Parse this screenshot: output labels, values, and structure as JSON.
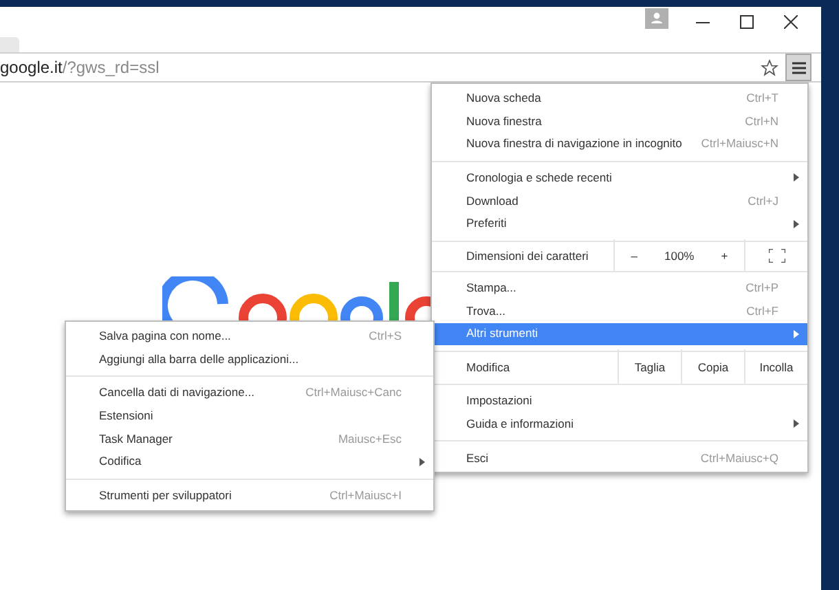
{
  "address_bar": {
    "host": "google.it",
    "path": "/?gws_rd=ssl",
    "menu_button_active": true
  },
  "menu": [
    {
      "kind": "item",
      "label": "Nuova scheda",
      "shortcut": "Ctrl+T",
      "submenu": false,
      "selected": false
    },
    {
      "kind": "item",
      "label": "Nuova finestra",
      "shortcut": "Ctrl+N",
      "submenu": false,
      "selected": false
    },
    {
      "kind": "item",
      "label": "Nuova finestra di navigazione in incognito",
      "shortcut": "Ctrl+Maiusc+N",
      "submenu": false,
      "selected": false
    },
    {
      "kind": "separator"
    },
    {
      "kind": "item",
      "label": "Cronologia e schede recenti",
      "submenu": true,
      "selected": false
    },
    {
      "kind": "item",
      "label": "Download",
      "shortcut": "Ctrl+J",
      "submenu": false,
      "selected": false
    },
    {
      "kind": "item",
      "label": "Preferiti",
      "submenu": true,
      "selected": false
    },
    {
      "kind": "separator"
    },
    {
      "kind": "zoom",
      "label": "Dimensioni dei caratteri",
      "minus": "–",
      "value": "100%",
      "plus": "+"
    },
    {
      "kind": "separator"
    },
    {
      "kind": "item",
      "label": "Stampa...",
      "shortcut": "Ctrl+P",
      "submenu": false,
      "selected": false
    },
    {
      "kind": "item",
      "label": "Trova...",
      "shortcut": "Ctrl+F",
      "submenu": false,
      "selected": false
    },
    {
      "kind": "item",
      "label": "Altri strumenti",
      "submenu": true,
      "selected": true
    },
    {
      "kind": "separator"
    },
    {
      "kind": "edit",
      "label": "Modifica",
      "buttons": [
        "Taglia",
        "Copia",
        "Incolla"
      ]
    },
    {
      "kind": "separator"
    },
    {
      "kind": "item",
      "label": "Impostazioni",
      "submenu": false,
      "selected": false
    },
    {
      "kind": "item",
      "label": "Guida e informazioni",
      "submenu": true,
      "selected": false
    },
    {
      "kind": "separator"
    },
    {
      "kind": "item",
      "label": "Esci",
      "shortcut": "Ctrl+Maiusc+Q",
      "submenu": false,
      "selected": false
    }
  ],
  "submenu": [
    {
      "kind": "item",
      "label": "Salva pagina con nome...",
      "shortcut": "Ctrl+S",
      "submenu": false,
      "selected": false
    },
    {
      "kind": "item",
      "label": "Aggiungi alla barra delle applicazioni...",
      "submenu": false,
      "selected": false
    },
    {
      "kind": "separator"
    },
    {
      "kind": "item",
      "label": "Cancella dati di navigazione...",
      "shortcut": "Ctrl+Maiusc+Canc",
      "submenu": false,
      "selected": false
    },
    {
      "kind": "item",
      "label": "Estensioni",
      "submenu": false,
      "selected": false
    },
    {
      "kind": "item",
      "label": "Task Manager",
      "shortcut": "Maiusc+Esc",
      "submenu": false,
      "selected": false
    },
    {
      "kind": "item",
      "label": "Codifica",
      "submenu": true,
      "selected": false
    },
    {
      "kind": "separator"
    },
    {
      "kind": "item",
      "label": "Strumenti per sviluppatori",
      "shortcut": "Ctrl+Maiusc+I",
      "submenu": false,
      "selected": false
    }
  ]
}
